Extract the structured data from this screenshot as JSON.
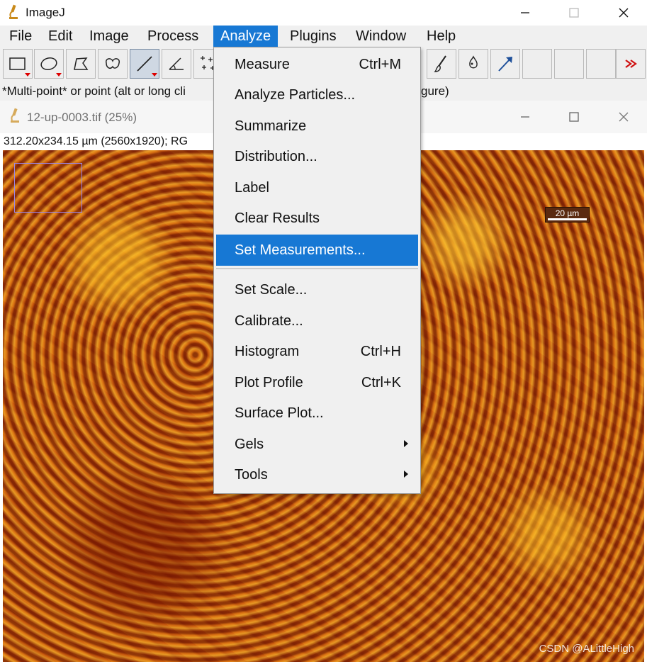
{
  "app": {
    "title": "ImageJ"
  },
  "menubar": {
    "items": [
      "File",
      "Edit",
      "Image",
      "Process",
      "Analyze",
      "Plugins",
      "Window",
      "Help"
    ],
    "active": "Analyze"
  },
  "status": {
    "text": "*Multi-point* or point (alt or long cli",
    "text_tail": "gure)"
  },
  "image_window": {
    "title": "12-up-0003.tif (25%)",
    "info": "312.20x234.15 µm (2560x1920); RG",
    "scalebar_label": "20 µm"
  },
  "analyze_menu": {
    "items": [
      {
        "label": "Measure",
        "shortcut": "Ctrl+M"
      },
      {
        "label": "Analyze Particles..."
      },
      {
        "label": "Summarize"
      },
      {
        "label": "Distribution..."
      },
      {
        "label": "Label"
      },
      {
        "label": "Clear Results"
      },
      {
        "label": "Set Measurements...",
        "highlighted": true
      },
      {
        "label": "Set Scale..."
      },
      {
        "label": "Calibrate..."
      },
      {
        "label": "Histogram",
        "shortcut": "Ctrl+H"
      },
      {
        "label": "Plot Profile",
        "shortcut": "Ctrl+K"
      },
      {
        "label": "Surface Plot..."
      },
      {
        "label": "Gels",
        "submenu": true
      },
      {
        "label": "Tools",
        "submenu": true
      }
    ]
  },
  "watermark": "CSDN @ALittleHigh",
  "colors": {
    "accent": "#1778d4",
    "menu_bg": "#f0f0f0"
  }
}
